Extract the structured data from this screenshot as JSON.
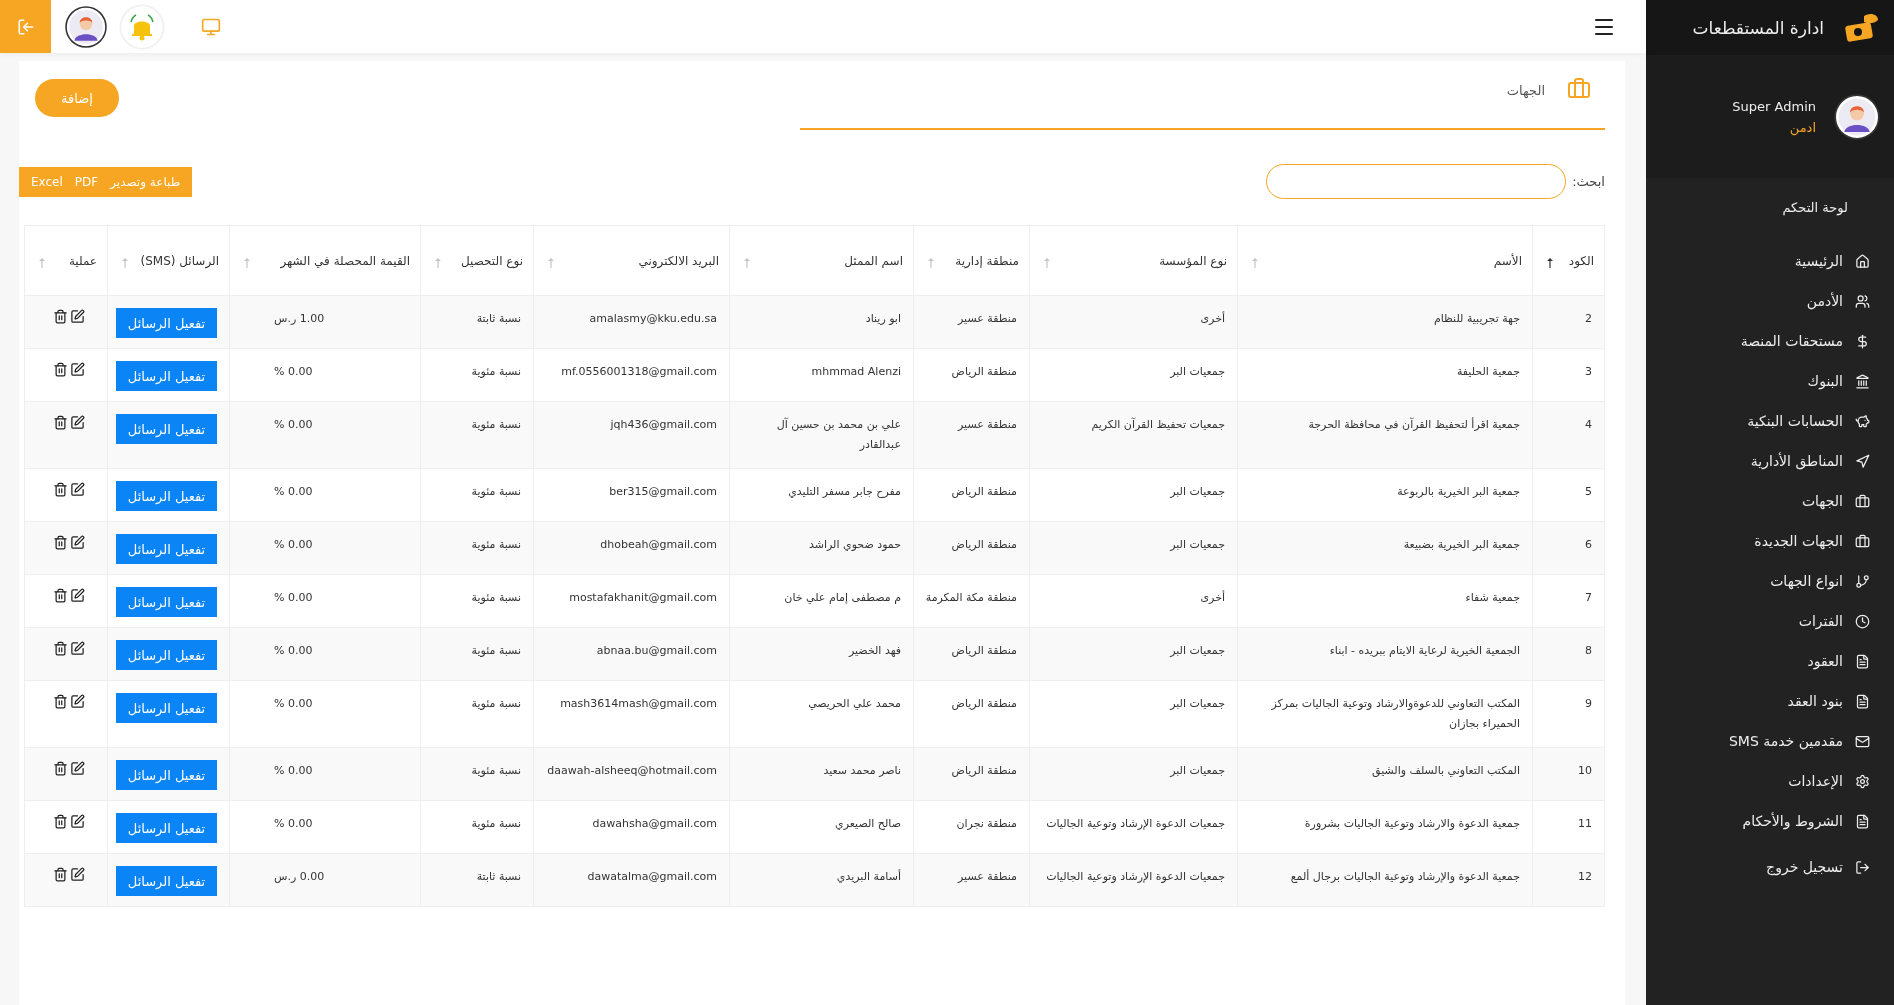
{
  "sidebar": {
    "brand": "ادارة المستقطعات",
    "user": {
      "name": "Super Admin",
      "role": "ادمن"
    },
    "section": "لوحة التحكم",
    "items": [
      {
        "label": "الرئيسية"
      },
      {
        "label": "الأدمن"
      },
      {
        "label": "مستحقات المنصة"
      },
      {
        "label": "البنوك"
      },
      {
        "label": "الحسابات البنكية"
      },
      {
        "label": "المناطق الأدارية"
      },
      {
        "label": "الجهات"
      },
      {
        "label": "الجهات الجديدة"
      },
      {
        "label": "انواع الجهات"
      },
      {
        "label": "الفترات"
      },
      {
        "label": "العقود"
      },
      {
        "label": "بنود العقد"
      },
      {
        "label": "مقدمين خدمة SMS"
      },
      {
        "label": "الإعدادات"
      },
      {
        "label": "الشروط والأحكام"
      },
      {
        "label": "تسجيل خروج"
      }
    ]
  },
  "page": {
    "title": "الجهات",
    "add_button": "إضافة",
    "search": {
      "label": "ابحث:"
    },
    "export_buttons": [
      "طباعة وتصدير",
      "PDF",
      "Excel"
    ]
  },
  "table": {
    "columns": [
      {
        "label": "الكود",
        "sorted": true
      },
      {
        "label": "الأسم",
        "sorted": false
      },
      {
        "label": "نوع المؤسسة",
        "sorted": false
      },
      {
        "label": "منطقة إدارية",
        "sorted": false
      },
      {
        "label": "اسم الممثل",
        "sorted": false
      },
      {
        "label": "البريد الالكتروني",
        "sorted": false
      },
      {
        "label": "نوع التحصيل",
        "sorted": false
      },
      {
        "label": "القيمة المحصلة في الشهر",
        "sorted": false
      },
      {
        "label": "الرسائل (SMS)",
        "sorted": false
      },
      {
        "label": "عملية",
        "sorted": false
      }
    ],
    "rows": [
      {
        "code": "2",
        "name": "جهة تجريبية للنظام",
        "type": "أخرى",
        "region": "منطقة عسير",
        "rep": "ابو ريناد",
        "email": "amalasmy@kku.edu.sa",
        "collection": "نسبة ثابتة",
        "value": "1.00 ر.س",
        "sms": "تفعيل الرسائل"
      },
      {
        "code": "3",
        "name": "جمعية الحليفة",
        "type": "جمعيات البر",
        "region": "منطقة الرياض",
        "rep": "mhmmad Alenzi",
        "email": "mf.0556001318@gmail.com",
        "collection": "نسبة مئوية",
        "value": "0.00 %",
        "sms": "تفعيل الرسائل"
      },
      {
        "code": "4",
        "name": "جمعية اقرأ لتحفيظ القرآن في محافظة الحرجة",
        "type": "جمعيات تحفيظ القرآن الكريم",
        "region": "منطقة عسير",
        "rep": "علي بن محمد بن حسين آل عبدالقادر",
        "email": "jqh436@gmail.com",
        "collection": "نسبة مئوية",
        "value": "0.00 %",
        "sms": "تفعيل الرسائل"
      },
      {
        "code": "5",
        "name": "جمعية البر الخيرية بالربوعة",
        "type": "جمعيات البر",
        "region": "منطقة الرياض",
        "rep": "مفرح جابر مسفر التليدي",
        "email": "ber315@gmail.com",
        "collection": "نسبة مئوية",
        "value": "0.00 %",
        "sms": "تفعيل الرسائل"
      },
      {
        "code": "6",
        "name": "جمعية البر الخيرية بضبيعة",
        "type": "جمعيات البر",
        "region": "منطقة الرياض",
        "rep": "حمود ضحوي الراشد",
        "email": "dhobeah@gmail.com",
        "collection": "نسبة مئوية",
        "value": "0.00 %",
        "sms": "تفعيل الرسائل"
      },
      {
        "code": "7",
        "name": "جمعية شفاء",
        "type": "أخرى",
        "region": "منطقة مكة المكرمة",
        "rep": "م مصطفى إمام علي خان",
        "email": "mostafakhanit@gmail.com",
        "collection": "نسبة مئوية",
        "value": "0.00 %",
        "sms": "تفعيل الرسائل"
      },
      {
        "code": "8",
        "name": "الجمعية الخيرية لرعاية الايتام ببريده - ابناء",
        "type": "جمعيات البر",
        "region": "منطقة الرياض",
        "rep": "فهد الخضير",
        "email": "abnaa.bu@gmail.com",
        "collection": "نسبة مئوية",
        "value": "0.00 %",
        "sms": "تفعيل الرسائل"
      },
      {
        "code": "9",
        "name": "المكتب التعاوني للدعوةوالارشاد وتوعية الجاليات بمركز الحميراء بجازان",
        "type": "جمعيات البر",
        "region": "منطقة الرياض",
        "rep": "محمد علي الحريصي",
        "email": "mash3614mash@gmail.com",
        "collection": "نسبة مئوية",
        "value": "0.00 %",
        "sms": "تفعيل الرسائل"
      },
      {
        "code": "10",
        "name": "المكتب التعاوني بالسلف والشيق",
        "type": "جمعيات البر",
        "region": "منطقة الرياض",
        "rep": "ناصر محمد سعيد",
        "email": "daawah-alsheeq@hotmail.com",
        "collection": "نسبة مئوية",
        "value": "0.00 %",
        "sms": "تفعيل الرسائل"
      },
      {
        "code": "11",
        "name": "جمعية الدعوة والارشاد وتوعية الجاليات بشرورة",
        "type": "جمعيات الدعوة الإرشاد وتوعية الجاليات",
        "region": "منطقة نجران",
        "rep": "صالح الصيعري",
        "email": "dawahsha@gmail.com",
        "collection": "نسبة مئوية",
        "value": "0.00 %",
        "sms": "تفعيل الرسائل"
      },
      {
        "code": "12",
        "name": "جمعية الدعوة والإرشاد وتوعية الجاليات برجال ألمع",
        "type": "جمعيات الدعوة الإرشاد وتوعية الجاليات",
        "region": "منطقة عسير",
        "rep": "أسامة البريدي",
        "email": "dawatalma@gmail.com",
        "collection": "نسبة ثابتة",
        "value": "0.00 ر.س",
        "sms": "تفعيل الرسائل"
      }
    ]
  }
}
